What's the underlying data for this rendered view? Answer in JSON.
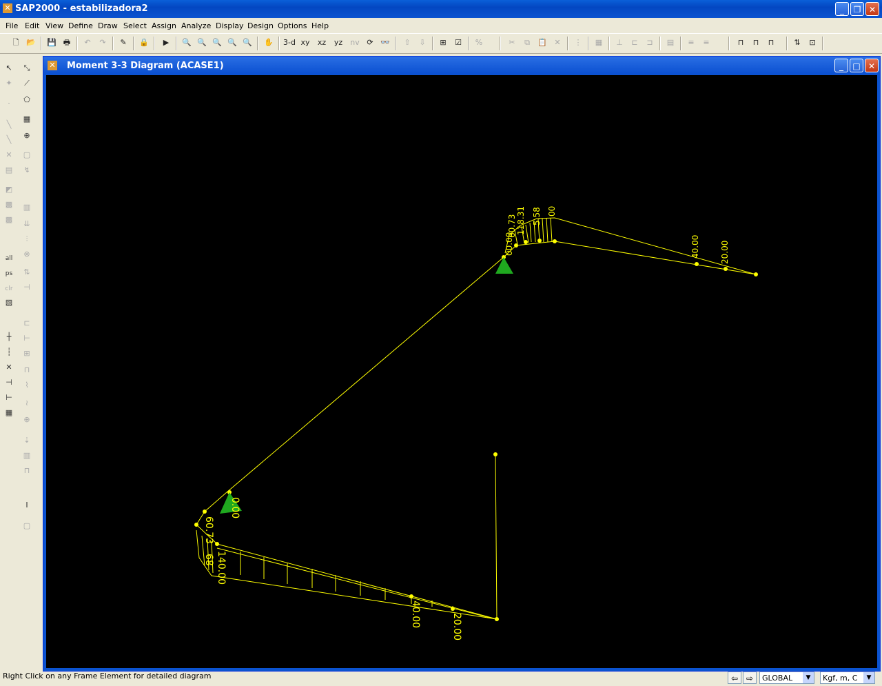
{
  "app": {
    "title": "SAP2000 - estabilizadora2",
    "window_buttons": [
      "minimize-icon",
      "restore-icon",
      "close-icon"
    ]
  },
  "menu": [
    "File",
    "Edit",
    "View",
    "Define",
    "Draw",
    "Select",
    "Assign",
    "Analyze",
    "Display",
    "Design",
    "Options",
    "Help"
  ],
  "toolbar": {
    "view_3d": "3-d",
    "view_xy": "xy",
    "view_xz": "xz",
    "view_yz": "yz",
    "view_nv": "nv"
  },
  "left_toolbar": {
    "all_label": "all",
    "ps_label": "ps",
    "clr_label": "clr"
  },
  "diagram_window": {
    "title": "Moment 3-3 Diagram   (ACASE1)",
    "background": "#000000",
    "line_color": "#ffff00",
    "support_color": "#1fa81f"
  },
  "diagram_labels": {
    "top_a": "00.00",
    "top_b": "60.73",
    "top_c": "118.31",
    "top_d": "5.58",
    "top_e": "00",
    "top_f": "40.00",
    "top_g": "20.00",
    "bot_a": "0.00",
    "bot_b": "60.73",
    "bot_c": "68",
    "bot_d": "140.00",
    "bot_e": "40.00",
    "bot_f": "20.00"
  },
  "status": {
    "message": "Right Click on any Frame Element for detailed diagram",
    "coord_system": "GLOBAL",
    "units": "Kgf, m, C"
  }
}
